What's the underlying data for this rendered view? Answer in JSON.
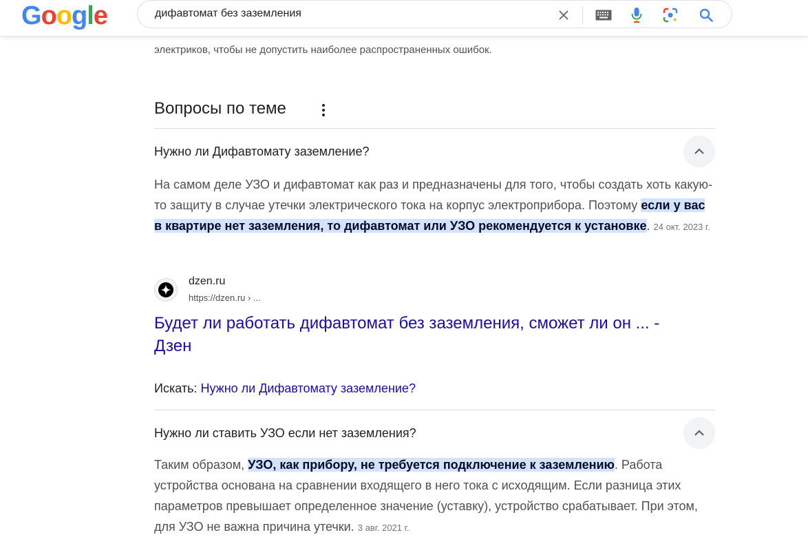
{
  "header": {
    "logo": [
      "G",
      "o",
      "o",
      "g",
      "l",
      "e"
    ],
    "logo_colors": [
      "#4285F4",
      "#EA4335",
      "#FBBC05",
      "#4285F4",
      "#34A853",
      "#EA4335"
    ],
    "query": "дифавтомат без заземления",
    "icons": [
      "close-icon",
      "keyboard-icon",
      "microphone-icon",
      "lens-icon",
      "search-icon"
    ]
  },
  "top_snippet": {
    "line": "электриков, чтобы не допустить наиболее распространенных ошибок."
  },
  "paa": {
    "title": "Вопросы по теме",
    "q1": {
      "question": "Нужно ли Дифавтомату заземление?",
      "answer_plain": "На самом деле УЗО и дифавтомат как раз и предназначены для того, чтобы создать хоть какую-то защиту в случае утечки электрического тока на корпус электроприбора. Поэтому ",
      "answer_highlight": "если у вас в квартире нет заземления, то дифавтомат или УЗО рекомендуется к установке",
      "answer_end": ".",
      "date": "24 окт. 2023 г.",
      "source_name": "dzen.ru",
      "source_url": "https://dzen.ru › ...",
      "link_title": "Будет ли работать дифавтомат без заземления, сможет ли он ... - Дзен",
      "ask_label": "Искать: ",
      "ask_link": "Нужно ли Дифавтомату заземление?"
    },
    "q2": {
      "question": "Нужно ли ставить УЗО если нет заземления?",
      "answer_start": "Таким образом, ",
      "answer_highlight": "УЗО, как прибору, не требуется подключение к заземлению",
      "answer_rest": ". Работа устройства основана на сравнении входящего в него тока с исходящим. Если разница этих параметров превышает определенное значение (уставку), устройство срабатывает. При этом, для УЗО не важна причина утечки.",
      "date": "3 авг. 2021 г."
    }
  },
  "colors": {
    "link": "#1a0dab",
    "highlight_bg": "#d3e3fd",
    "snippet_text": "#4d5156"
  }
}
